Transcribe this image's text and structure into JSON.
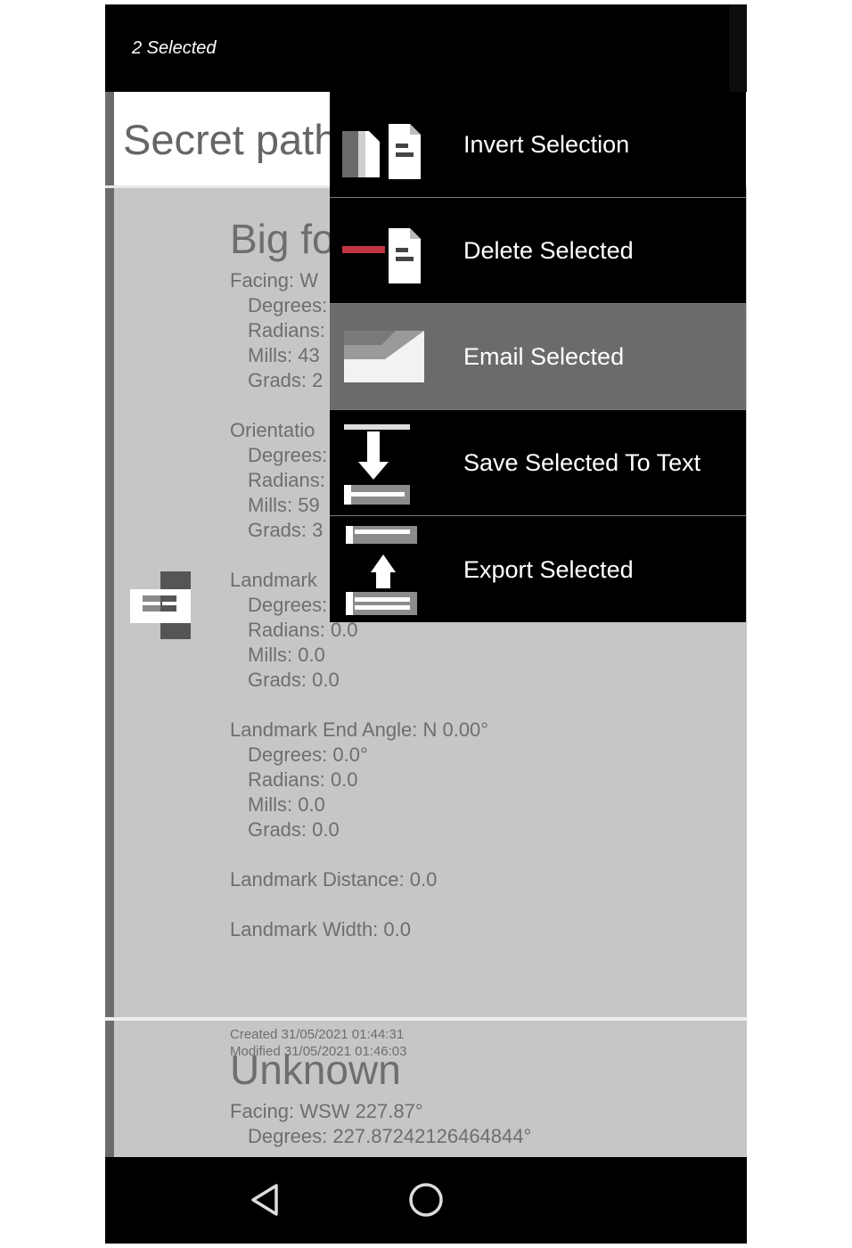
{
  "action_bar": {
    "selected_count": "2 Selected"
  },
  "list": {
    "header_title": "Secret path"
  },
  "card1": {
    "title": "Big fo",
    "lines": [
      {
        "text": "Facing: W",
        "indent": false
      },
      {
        "text": "Degrees:",
        "indent": true
      },
      {
        "text": "Radians:",
        "indent": true
      },
      {
        "text": "Mills: 43",
        "indent": true
      },
      {
        "text": "Grads: 2",
        "indent": true
      },
      {
        "text": "",
        "indent": false
      },
      {
        "text": "Orientatio",
        "indent": false
      },
      {
        "text": "Degrees:",
        "indent": true
      },
      {
        "text": "Radians:",
        "indent": true
      },
      {
        "text": "Mills: 59",
        "indent": true
      },
      {
        "text": "Grads: 3",
        "indent": true
      },
      {
        "text": "",
        "indent": false
      },
      {
        "text": "Landmark",
        "indent": false
      },
      {
        "text": "Degrees:",
        "indent": true
      },
      {
        "text": "Radians: 0.0",
        "indent": true
      },
      {
        "text": "Mills: 0.0",
        "indent": true
      },
      {
        "text": "Grads: 0.0",
        "indent": true
      },
      {
        "text": "",
        "indent": false
      },
      {
        "text": "Landmark End Angle: N 0.00°",
        "indent": false
      },
      {
        "text": "Degrees: 0.0°",
        "indent": true
      },
      {
        "text": "Radians: 0.0",
        "indent": true
      },
      {
        "text": "Mills: 0.0",
        "indent": true
      },
      {
        "text": "Grads: 0.0",
        "indent": true
      },
      {
        "text": "",
        "indent": false
      },
      {
        "text": "Landmark Distance: 0.0",
        "indent": false
      },
      {
        "text": "",
        "indent": false
      },
      {
        "text": "Landmark Width: 0.0",
        "indent": false
      }
    ],
    "created": "Created 31/05/2021 01:44:31",
    "modified": "Modified 31/05/2021 01:46:03",
    "icon": "selected-item-icon"
  },
  "card2": {
    "title": "Unknown",
    "facing": "Facing: WSW 227.87°",
    "degrees": "Degrees: 227.87242126464844°"
  },
  "menu": {
    "items": [
      {
        "label": "Invert Selection",
        "icon": "invert-selection-icon"
      },
      {
        "label": "Delete Selected",
        "icon": "delete-selected-icon"
      },
      {
        "label": "Email Selected",
        "icon": "email-icon"
      },
      {
        "label": "Save Selected To Text",
        "icon": "save-to-text-icon"
      },
      {
        "label": "Export Selected",
        "icon": "export-icon"
      }
    ],
    "highlighted_index": 2
  },
  "colors": {
    "menu_bg": "#000000",
    "highlight_bg": "#6b6b6b",
    "delete_accent": "#c0343f"
  }
}
